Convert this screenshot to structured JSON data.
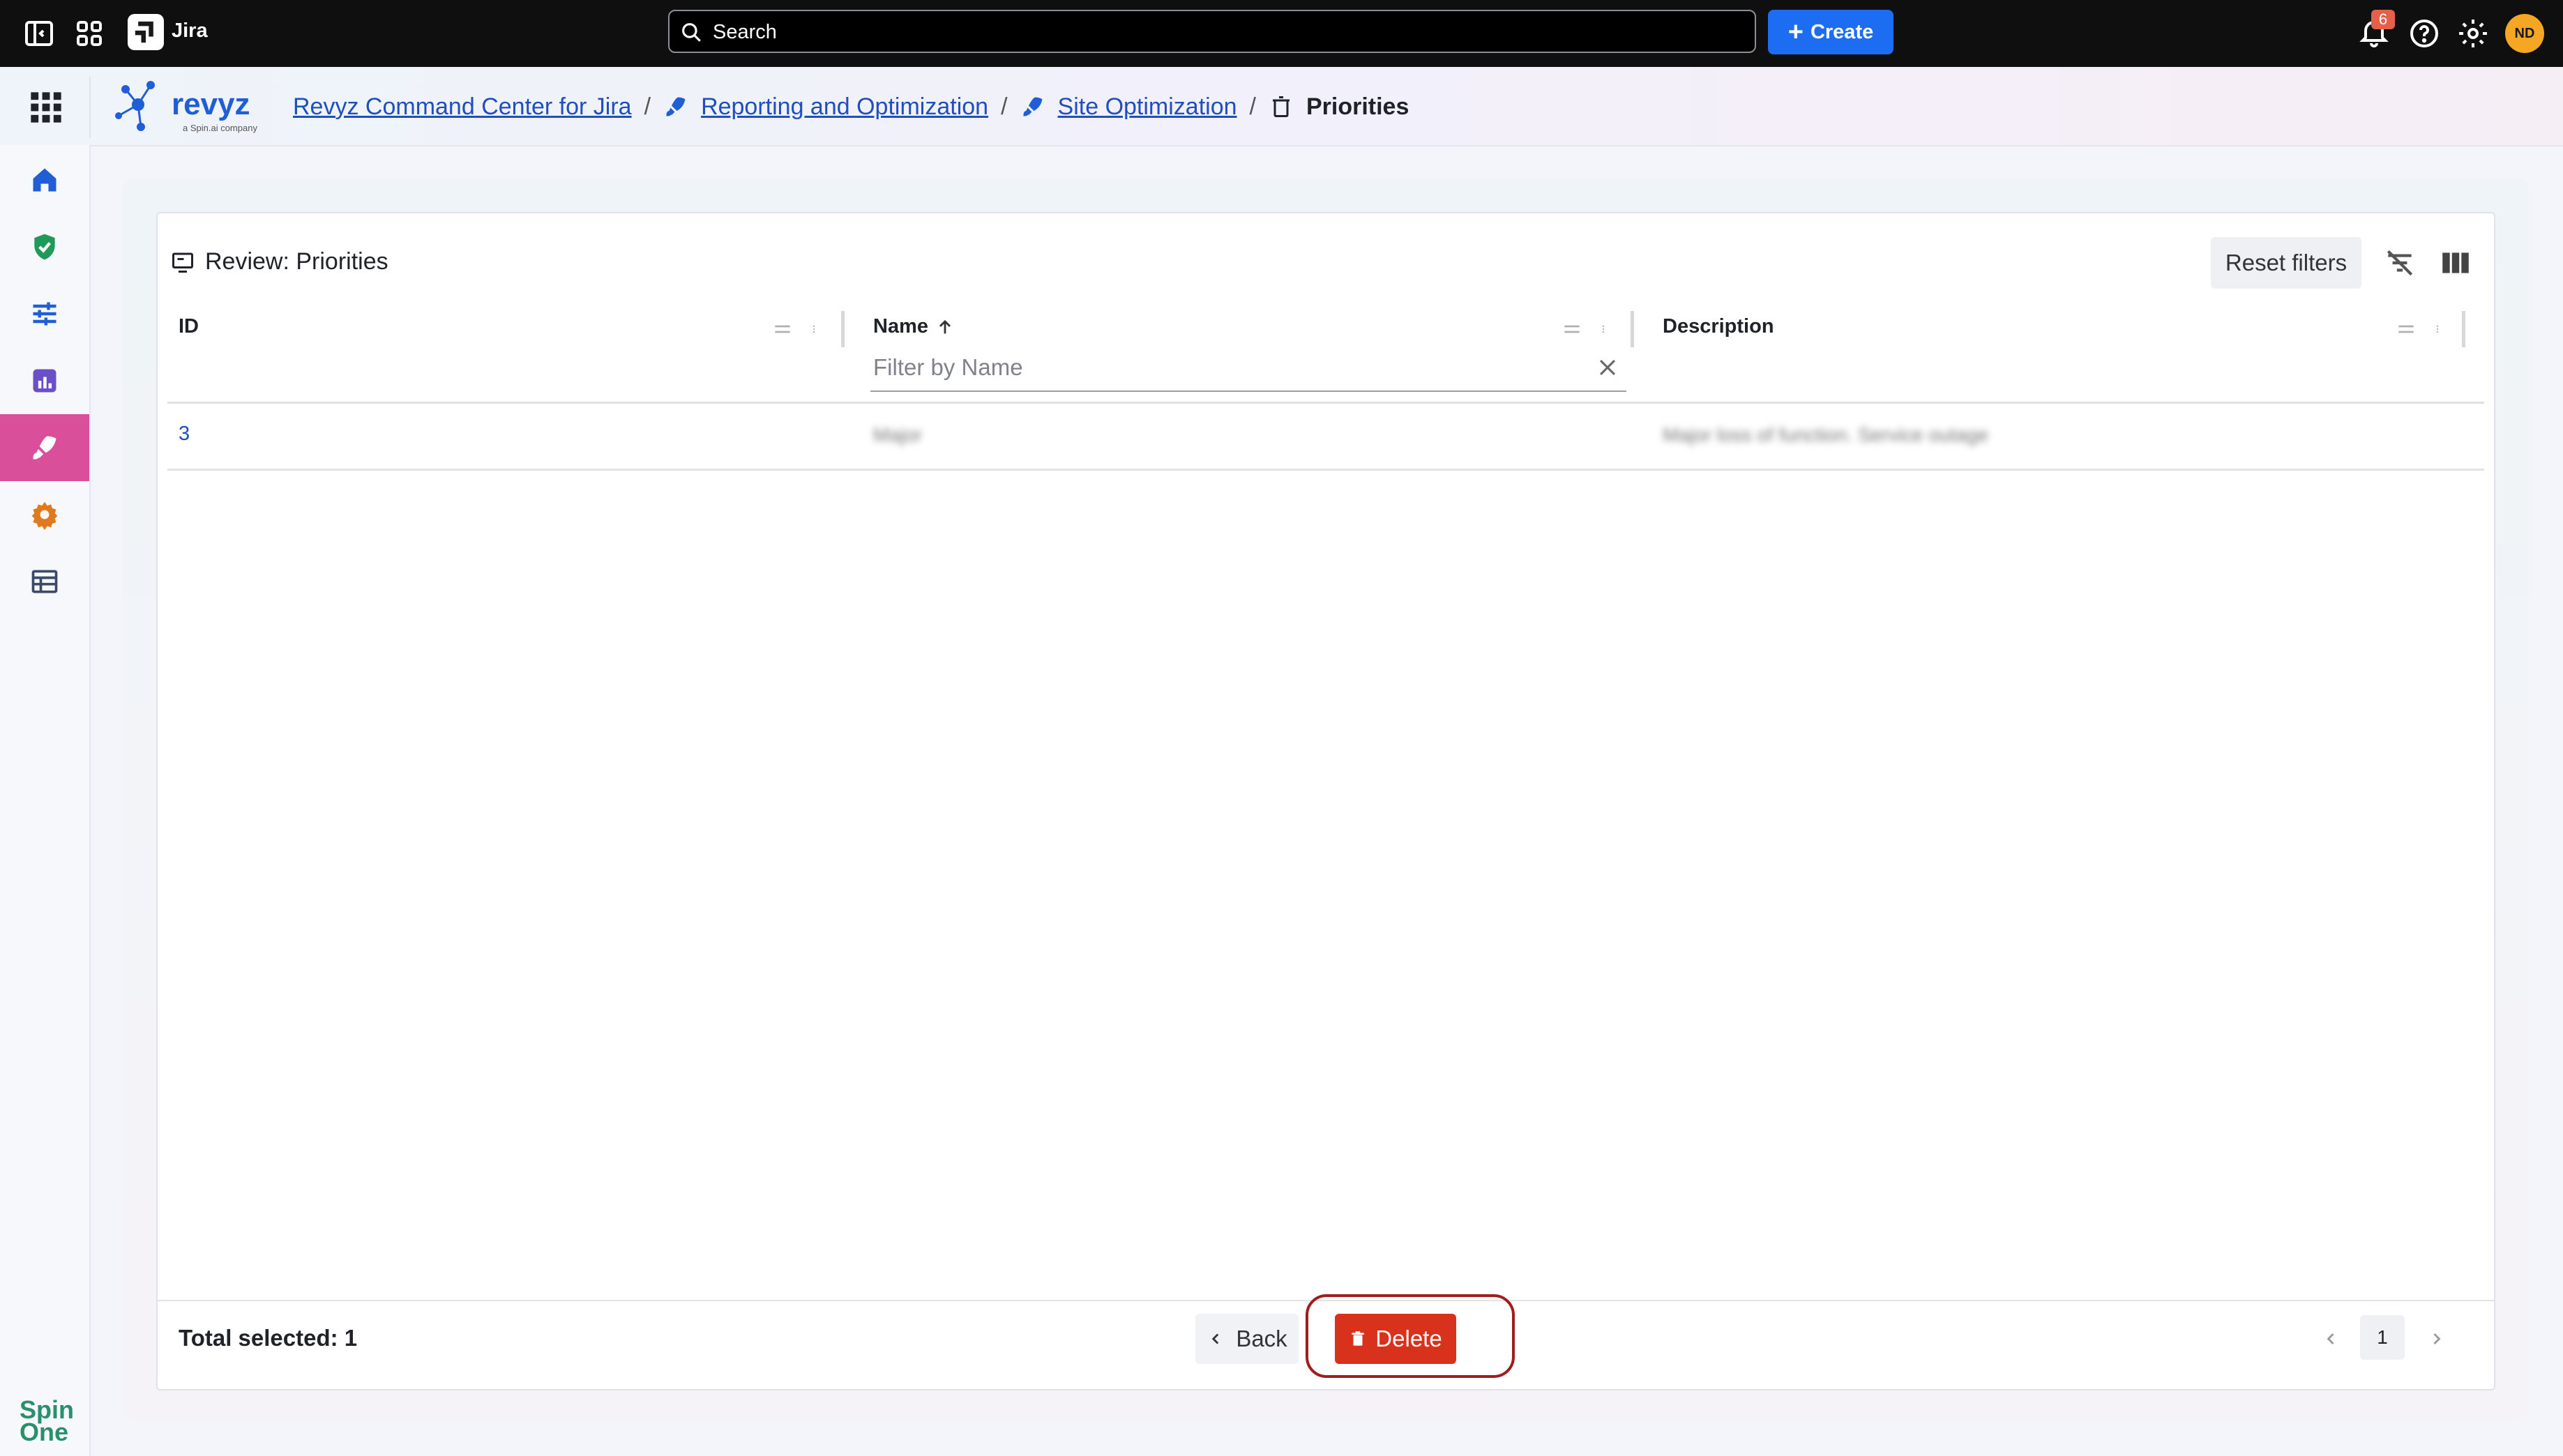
{
  "topbar": {
    "app_name": "Jira",
    "search_placeholder": "Search",
    "create_label": "Create",
    "notification_count": "6",
    "avatar_initials": "ND"
  },
  "breadcrumb": {
    "items": [
      "Revyz Command Center for Jira",
      "Reporting and Optimization",
      "Site Optimization"
    ],
    "current": "Priorities"
  },
  "brand": {
    "logo_text": "revyz",
    "logo_subtext": "a Spin.ai company",
    "footer_logo": "Spin One"
  },
  "panel": {
    "title": "Review: Priorities",
    "reset_label": "Reset filters"
  },
  "table": {
    "columns": [
      "ID",
      "Name",
      "Description"
    ],
    "filter_placeholder": "Filter by Name",
    "rows": [
      {
        "id": "3",
        "name": "Major",
        "description": "Major loss of function. Service outage"
      }
    ]
  },
  "footer": {
    "total_label": "Total selected: 1",
    "back_label": "Back",
    "delete_label": "Delete",
    "page": "1"
  },
  "colors": {
    "accent": "#1d6df2",
    "danger": "#d9321c",
    "active_nav": "#d94f9a",
    "link": "#1f4fbf"
  },
  "icons": {
    "sidebar": [
      "home-icon",
      "shield-check-icon",
      "sliders-icon",
      "report-chart-icon",
      "rocket-icon",
      "gear-icon",
      "table-icon"
    ]
  }
}
